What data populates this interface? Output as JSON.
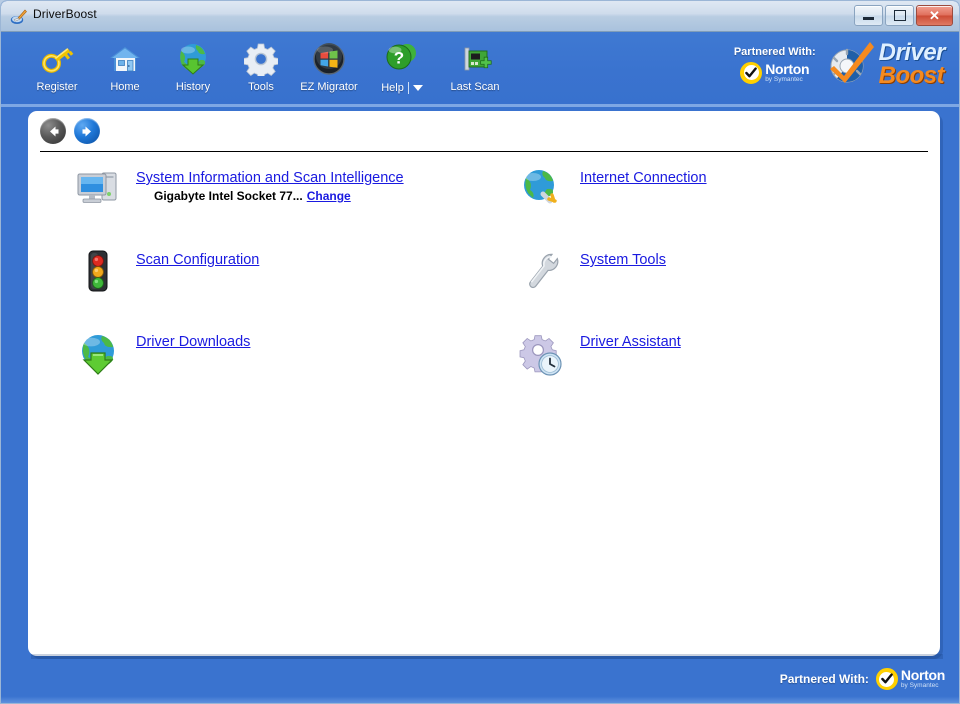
{
  "window": {
    "title": "DriverBoost",
    "app_icon": "driverboost-brush-icon",
    "minimize_label": "Minimize",
    "maximize_label": "Maximize",
    "close_label": "Close",
    "frame_color": "#3a73cf",
    "titlebar_color": "#cfdcec"
  },
  "toolbar": {
    "items": [
      {
        "label": "Register",
        "icon": "key-icon"
      },
      {
        "label": "Home",
        "icon": "house-icon"
      },
      {
        "label": "History",
        "icon": "globe-download-icon"
      },
      {
        "label": "Tools",
        "icon": "gear-icon"
      },
      {
        "label": "EZ Migrator",
        "icon": "windows-flag-icon"
      },
      {
        "label": "Help",
        "icon": "help-question-icon",
        "has_dropdown": true
      },
      {
        "label": "Last Scan",
        "icon": "network-card-plus-icon"
      }
    ],
    "help_caret": "chevron-down-icon"
  },
  "branding": {
    "partnered_with": "Partnered With:",
    "norton_name": "Norton",
    "norton_sub": "by Symantec",
    "norton_icon": "norton-checkmark-icon",
    "product_word1": "Driver",
    "product_word2": "Boost",
    "product_icon": "driverboost-logo-icon",
    "accent_orange": "#f58a1f",
    "accent_blue": "#dff0ff"
  },
  "nav": {
    "back_label": "Back",
    "back_icon": "arrow-left-icon",
    "back_enabled": false,
    "forward_label": "Forward",
    "forward_icon": "arrow-right-icon",
    "forward_enabled": true
  },
  "main": {
    "rows": [
      {
        "left": {
          "icon": "computer-monitor-icon",
          "link": "System Information and Scan Intelligence",
          "subtext": "Gigabyte Intel Socket 77...",
          "sub_link": "Change"
        },
        "right": {
          "icon": "globe-plug-icon",
          "link": "Internet Connection"
        }
      },
      {
        "left": {
          "icon": "traffic-light-icon",
          "link": "Scan Configuration"
        },
        "right": {
          "icon": "wrench-icon",
          "link": "System Tools"
        }
      },
      {
        "left": {
          "icon": "globe-download-arrow-icon",
          "link": "Driver Downloads"
        },
        "right": {
          "icon": "gear-clock-icon",
          "link": "Driver Assistant"
        }
      }
    ],
    "link_color": "#1a1ae0"
  },
  "statusbar": {
    "partnered_with": "Partnered With:",
    "norton_name": "Norton",
    "norton_sub": "by Symantec",
    "norton_icon": "norton-checkmark-icon"
  }
}
